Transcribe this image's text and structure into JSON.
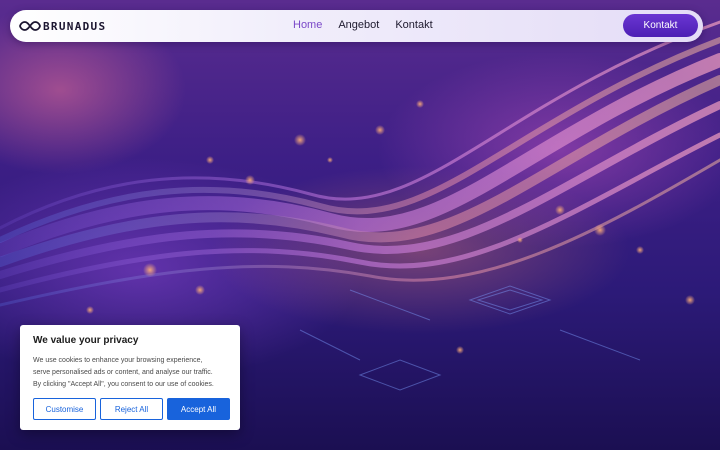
{
  "brand": {
    "name": "BRUNADUS",
    "logo_icon": "infinity-icon"
  },
  "nav": {
    "links": [
      {
        "label": "Home",
        "active": true
      },
      {
        "label": "Angebot",
        "active": false
      },
      {
        "label": "Kontakt",
        "active": false
      }
    ],
    "cta_label": "Kontakt"
  },
  "cookie_banner": {
    "title": "We value your privacy",
    "text_lines": [
      "We use cookies to enhance your browsing experience,",
      "serve personalised ads or content, and analyse our traffic.",
      "By clicking \"Accept All\", you consent to our use of cookies."
    ],
    "buttons": {
      "customise": "Customise",
      "reject": "Reject All",
      "accept": "Accept All"
    }
  },
  "colors": {
    "accent": "#6a35d2",
    "active_link": "#7a48c8",
    "cookie_button": "#1863dc"
  }
}
